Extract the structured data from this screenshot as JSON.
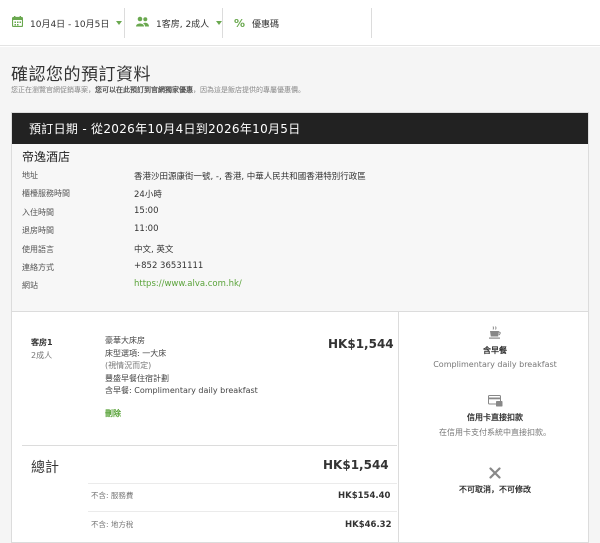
{
  "topbar": {
    "dates": "10月4日 - 10月5日",
    "guests": "1客房, 2成人",
    "promo": "優惠碼"
  },
  "page": {
    "title": "確認您的預訂資料",
    "subtitle_pre": "您正在瀏覽官網促銷專案，",
    "subtitle_bold": "您可以在此預訂到官網獨家優惠",
    "subtitle_post": "，因為這是飯店提供的專屬優惠價。"
  },
  "booking": {
    "header": "預訂日期 - 從2026年10月4日到2026年10月5日",
    "hotel_name": "帝逸酒店",
    "rows": [
      {
        "label": "地址",
        "value": "香港沙田源康街一號, -, 香港, 中華人民共和國香港特別行政區"
      },
      {
        "label": "櫃檯服務時間",
        "value": "24小時"
      },
      {
        "label": "入住時間",
        "value": "15:00"
      },
      {
        "label": "退房時間",
        "value": "11:00"
      },
      {
        "label": "使用語言",
        "value": "中文, 英文"
      },
      {
        "label": "連絡方式",
        "value": "+852 36531111"
      },
      {
        "label": "網站",
        "value": "https://www.alva.com.hk/"
      }
    ]
  },
  "room": {
    "label": "客房1",
    "guests": "2成人",
    "desc": [
      "豪華大床房",
      "床型選項: 一大床",
      "(視情況而定)",
      "豐盛早餐住宿計劃",
      "含早餐: Complimentary daily breakfast"
    ],
    "delete": "刪除",
    "price": "HK$1,544"
  },
  "total": {
    "label": "總計",
    "amount": "HK$1,544",
    "fees": [
      {
        "label": "不含: 服務費",
        "value": "HK$154.40"
      },
      {
        "label": "不含: 地方稅",
        "value": "HK$46.32"
      }
    ]
  },
  "perks": [
    {
      "icon": "coffee-cup-icon",
      "title": "含早餐",
      "sub": "Complimentary daily breakfast"
    },
    {
      "icon": "credit-card-icon",
      "title": "信用卡直接扣款",
      "sub": "在信用卡支付系統中直接扣款。"
    },
    {
      "icon": "cross-icon",
      "title": "不可取消，不可修改",
      "sub": ""
    }
  ],
  "colors": {
    "accent": "#5aa33a",
    "header_bg": "#222222"
  }
}
